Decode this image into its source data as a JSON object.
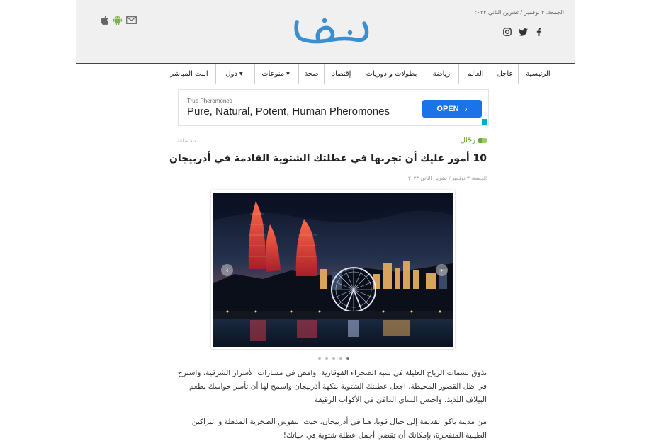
{
  "header": {
    "date": "الجمعة، ٣ نوفمبر / تشرين الثاني ٢٠٢٣",
    "logo_text": "نبض",
    "social_icons": [
      "facebook-icon",
      "twitter-icon",
      "instagram-icon"
    ],
    "app_icons": [
      "mail-icon",
      "android-icon",
      "apple-icon"
    ],
    "logo_color": "#3b8fd0"
  },
  "nav": {
    "items": [
      {
        "label": "الرئيسية"
      },
      {
        "label": "عاجل"
      },
      {
        "label": "العالم"
      },
      {
        "label": "رياضة"
      },
      {
        "label": "بطولات و دوريات"
      },
      {
        "label": "إقتصاد"
      },
      {
        "label": "صحة"
      },
      {
        "label": "منوعات"
      },
      {
        "label": "دول"
      },
      {
        "label": "البث المباشر"
      }
    ]
  },
  "ad": {
    "small_text": "True Pheromones",
    "headline": "Pure, Natural, Potent, Human Pheromones",
    "button_label": "OPEN",
    "button_color": "#1a73e8"
  },
  "article": {
    "source": "رحّال",
    "time_ago": "منذ ساعة",
    "title": "10 أمور عليك أن تجربها في عطلتك الشتوية القادمة في أذربيجان",
    "date": "الجمعة، ٣ نوفمبر / تشرين الثاني ٢٠٢٣",
    "slider": {
      "slide_count": 5,
      "active_index": 4
    },
    "paragraph1": "تذوق نسمات الرياح العليلة في شبه الصحراء القوقازية، وامض في مسارات الأسرار الشرقية، واسترح في ظل القصور المحيطة. اجعل عطلتك الشتوية بنكهة أذربيجان واسمح لها أن تأسر حواسك بطعم البيلاف اللذيذ، واحتس الشاي الدافئ في الأكواب الرقيقة",
    "paragraph2": "من مدينة باكو القديمة إلى جبال قوبا، هنا في أذربيجان، حيث النقوش الصخرية المذهلة و البراكين الطينية المتفجرة، بإمكانك أن تقضي أجمل عطلة شتوية في حياتك!"
  }
}
